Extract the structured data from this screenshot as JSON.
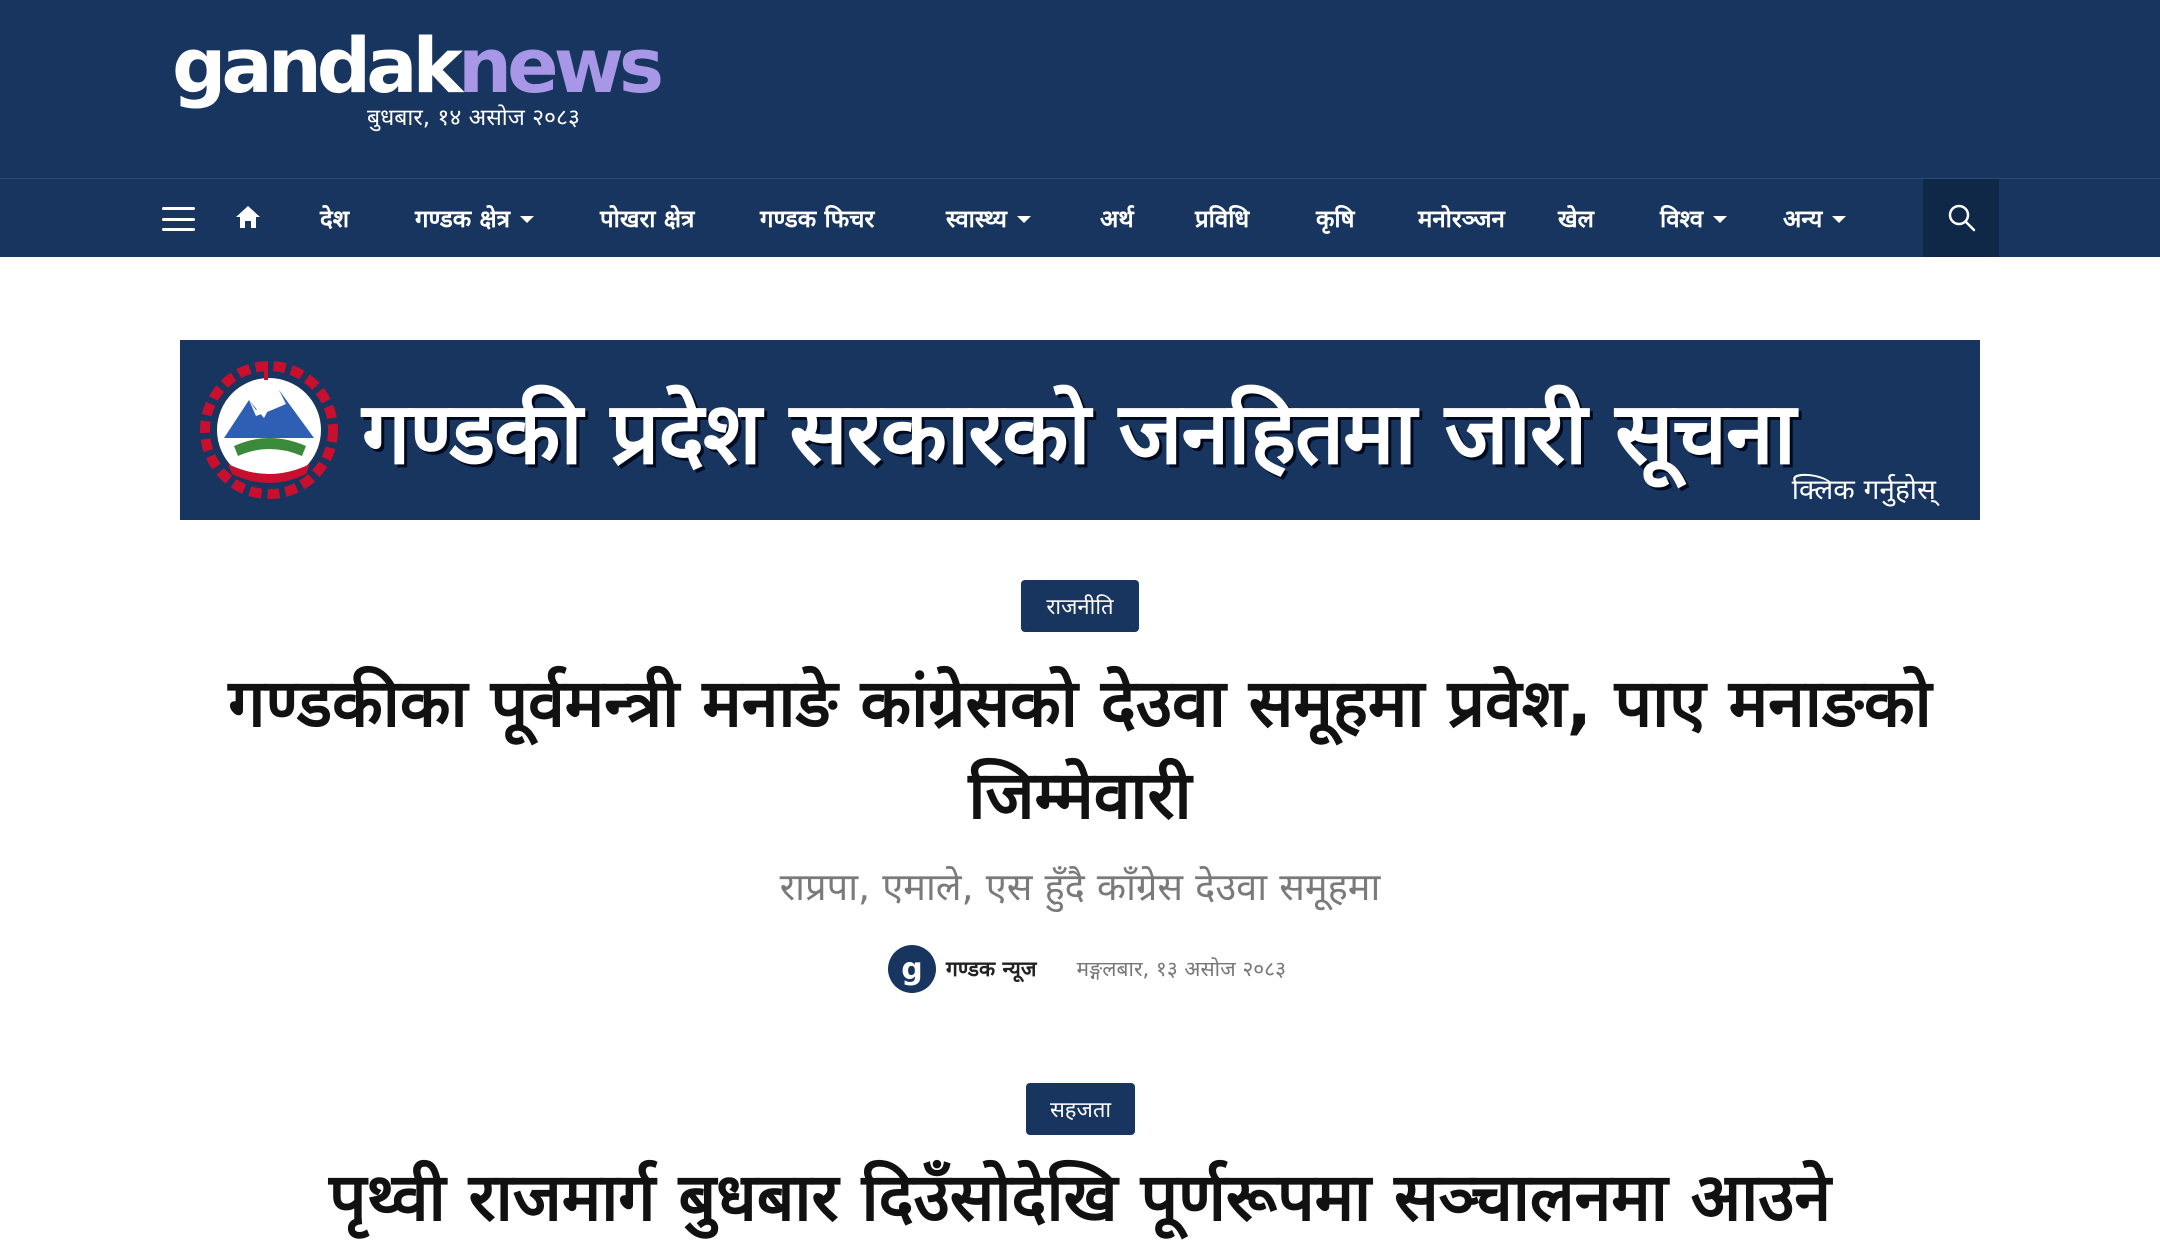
{
  "header": {
    "logo_part1": "gandak",
    "logo_part2": "news",
    "date": "बुधबार, १४ असोज २०८३"
  },
  "nav": {
    "items": [
      {
        "label": "देश"
      },
      {
        "label": "गण्डक क्षेत्र"
      },
      {
        "label": "पोखरा क्षेत्र"
      },
      {
        "label": "गण्डक फिचर"
      },
      {
        "label": "स्वास्थ्य"
      },
      {
        "label": "अर्थ"
      },
      {
        "label": "प्रविधि"
      },
      {
        "label": "कृषि"
      },
      {
        "label": "मनोरञ्जन"
      },
      {
        "label": "खेल"
      },
      {
        "label": "विश्व"
      },
      {
        "label": "अन्य"
      }
    ],
    "icons": [
      "menu-icon",
      "home-icon",
      "search-icon"
    ]
  },
  "banner": {
    "title": "गण्डकी प्रदेश सरकारको जनहितमा जारी सूचना",
    "cta": "क्लिक गर्नुहोस्"
  },
  "articles": [
    {
      "category": "राजनीति",
      "headline": "गण्डकीका पूर्वमन्त्री मनाङे कांग्रेसको देउवा समूहमा प्रवेश, पाए मनाङको जिम्मेवारी",
      "subheadline": "राप्रपा, एमाले, एस हुँदै काँग्रेस देउवा समूहमा",
      "author": "गण्डक न्यूज",
      "date": "मङ्गलबार, १३ असोज २०८३"
    },
    {
      "category": "सहजता",
      "headline": "पृथ्वी राजमार्ग बुधबार दिउँसोदेखि पूर्णरूपमा सञ्चालनमा आउने"
    }
  ],
  "colors": {
    "brand_navy": "#17355f",
    "logo_accent": "#a896e6",
    "search_bg": "#0f2847"
  }
}
